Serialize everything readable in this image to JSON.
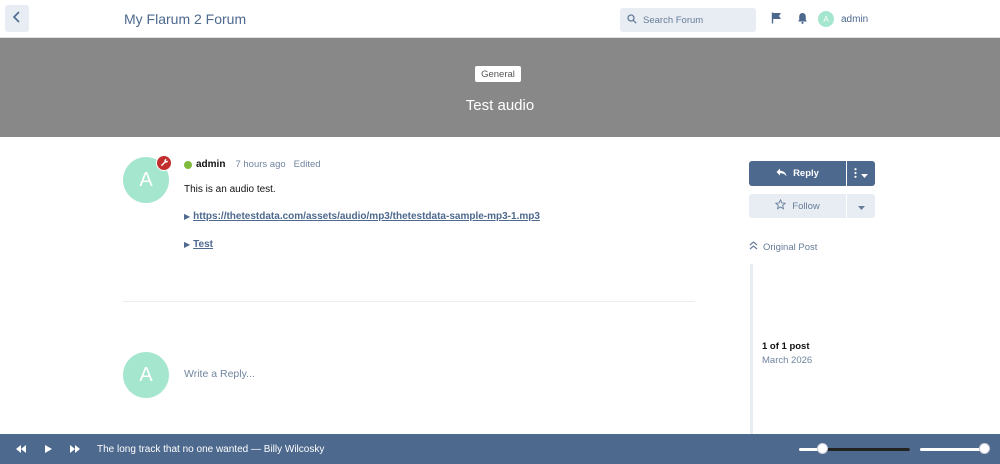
{
  "header": {
    "forum_title": "My Flarum 2 Forum",
    "search_placeholder": "Search Forum",
    "user": {
      "initial": "A",
      "name": "admin"
    }
  },
  "hero": {
    "tag": "General",
    "title": "Test audio"
  },
  "post": {
    "author_initial": "A",
    "author": "admin",
    "time": "7 hours ago",
    "edited": "Edited",
    "body": "This is an audio test.",
    "links": [
      {
        "text": "https://thetestdata.com/assets/audio/mp3/thetestdata-sample-mp3-1.mp3"
      },
      {
        "text": "Test"
      }
    ]
  },
  "reply_composer": {
    "user_initial": "A",
    "placeholder": "Write a Reply..."
  },
  "sidebar": {
    "reply_label": "Reply",
    "follow_label": "Follow",
    "original_post_label": "Original Post",
    "scrubber_position": "1 of 1 post",
    "scrubber_date": "March 2026"
  },
  "player": {
    "track": "The long track that no one wanted — Billy Wilcosky",
    "progress": 0.22,
    "volume": 0.95
  },
  "colors": {
    "primary": "#4d698e",
    "hero_bg": "#888888",
    "avatar": "#a5e6cf",
    "badge": "#c22d2d",
    "online": "#7fba3d"
  }
}
